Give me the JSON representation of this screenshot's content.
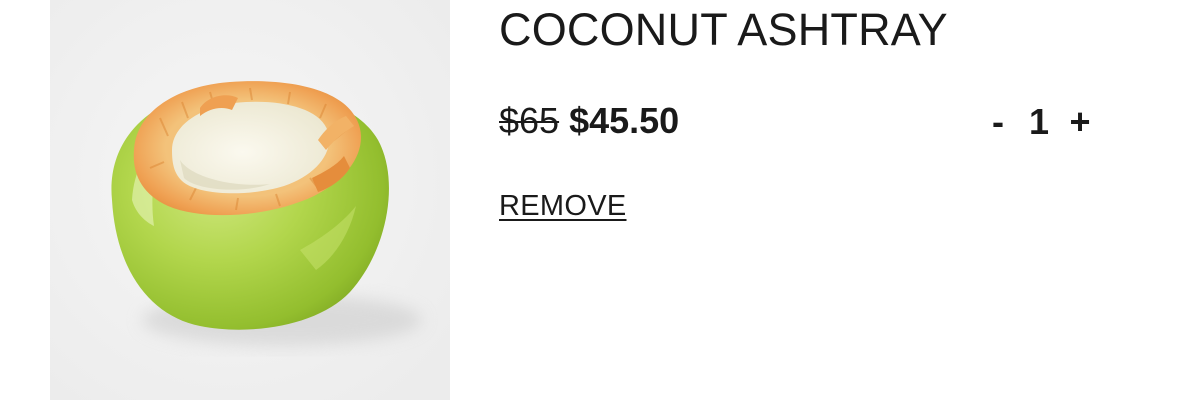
{
  "cart_item": {
    "image_alt": "Coconut ashtray product photo",
    "title": "COCONUT ASHTRAY",
    "price_original": "$65",
    "price_sale": "$45.50",
    "quantity": {
      "decrement_label": "-",
      "value": "1",
      "increment_label": "+"
    },
    "remove_label": "REMOVE"
  },
  "colors": {
    "image_background": "#f0f0f0",
    "coconut_green": "#a8cf45",
    "coconut_rim": "#f2a75c",
    "coconut_inside": "#f7f4e4",
    "text": "#1a1a1a"
  }
}
